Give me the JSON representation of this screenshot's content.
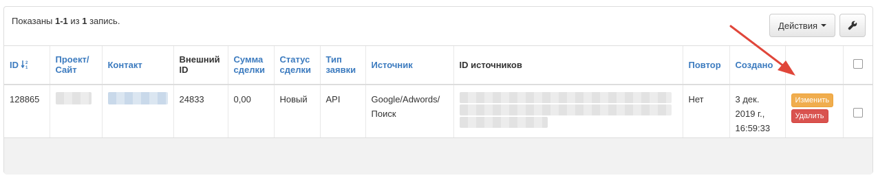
{
  "summary": {
    "prefix": "Показаны ",
    "range": "1-1",
    "middle": " из ",
    "total": "1",
    "suffix": " запись."
  },
  "toolbar": {
    "actions_label": "Действия",
    "tool_icon": "wrench-icon"
  },
  "columns": {
    "id": "ID",
    "project_line1": "Проект/",
    "project_line2": "Сайт",
    "contact": "Контакт",
    "external_line1": "Внешний",
    "external_line2": "ID",
    "sum_line1": "Сумма",
    "sum_line2": "сделки",
    "status_line1": "Статус",
    "status_line2": "сделки",
    "type_line1": "Тип",
    "type_line2": "заявки",
    "source": "Источник",
    "source_ids": "ID источников",
    "repeat": "Повтор",
    "created": "Создано"
  },
  "row": {
    "id": "128865",
    "external_id": "24833",
    "sum": "0,00",
    "status": "Новый",
    "type": "API",
    "source_line1": "Google/Adwords/",
    "source_line2": "Поиск",
    "repeat": "Нет",
    "created_line1": "3 дек.",
    "created_line2": "2019 г.,",
    "created_line3": "16:59:33",
    "edit_label": "Изменить",
    "delete_label": "Удалить"
  },
  "colors": {
    "link": "#3c7bbf",
    "edit": "#f0ad4e",
    "delete": "#d9534f",
    "arrow": "#e0463a"
  }
}
